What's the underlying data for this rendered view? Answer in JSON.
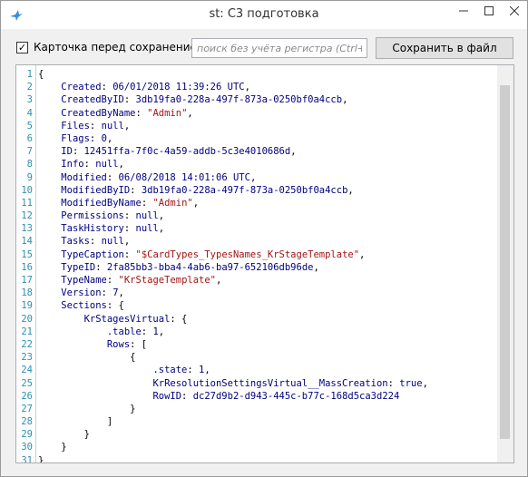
{
  "window": {
    "title": "st: C3 подготовка"
  },
  "toolbar": {
    "checkbox_label": "Карточка перед сохранением",
    "checkbox_checked": true,
    "search_placeholder": "поиск без учёта регистра (Ctrl+F",
    "save_label": "Сохранить в файл"
  },
  "editor": {
    "lines": [
      {
        "n": "1",
        "segments": [
          [
            "{",
            "p"
          ]
        ]
      },
      {
        "n": "2",
        "segments": [
          [
            "    ",
            "p"
          ],
          [
            "Created",
            "k"
          ],
          [
            ": ",
            "p"
          ],
          [
            "06/01/2018 11:39:26 UTC",
            "v"
          ],
          [
            ",",
            "p"
          ]
        ]
      },
      {
        "n": "3",
        "segments": [
          [
            "    ",
            "p"
          ],
          [
            "CreatedByID",
            "k"
          ],
          [
            ": ",
            "p"
          ],
          [
            "3db19fa0-228a-497f-873a-0250bf0a4ccb",
            "v"
          ],
          [
            ",",
            "p"
          ]
        ]
      },
      {
        "n": "4",
        "segments": [
          [
            "    ",
            "p"
          ],
          [
            "CreatedByName",
            "k"
          ],
          [
            ": ",
            "p"
          ],
          [
            "\"Admin\"",
            "s"
          ],
          [
            ",",
            "p"
          ]
        ]
      },
      {
        "n": "5",
        "segments": [
          [
            "    ",
            "p"
          ],
          [
            "Files",
            "k"
          ],
          [
            ": ",
            "p"
          ],
          [
            "null",
            "n"
          ],
          [
            ",",
            "p"
          ]
        ]
      },
      {
        "n": "6",
        "segments": [
          [
            "    ",
            "p"
          ],
          [
            "Flags",
            "k"
          ],
          [
            ": ",
            "p"
          ],
          [
            "0",
            "v"
          ],
          [
            ",",
            "p"
          ]
        ]
      },
      {
        "n": "7",
        "segments": [
          [
            "    ",
            "p"
          ],
          [
            "ID",
            "k"
          ],
          [
            ": ",
            "p"
          ],
          [
            "12451ffa-7f0c-4a59-addb-5c3e4010686d",
            "v"
          ],
          [
            ",",
            "p"
          ]
        ]
      },
      {
        "n": "8",
        "segments": [
          [
            "    ",
            "p"
          ],
          [
            "Info",
            "k"
          ],
          [
            ": ",
            "p"
          ],
          [
            "null",
            "n"
          ],
          [
            ",",
            "p"
          ]
        ]
      },
      {
        "n": "9",
        "segments": [
          [
            "    ",
            "p"
          ],
          [
            "Modified",
            "k"
          ],
          [
            ": ",
            "p"
          ],
          [
            "06/08/2018 14:01:06 UTC",
            "v"
          ],
          [
            ",",
            "p"
          ]
        ]
      },
      {
        "n": "10",
        "segments": [
          [
            "    ",
            "p"
          ],
          [
            "ModifiedByID",
            "k"
          ],
          [
            ": ",
            "p"
          ],
          [
            "3db19fa0-228a-497f-873a-0250bf0a4ccb",
            "v"
          ],
          [
            ",",
            "p"
          ]
        ]
      },
      {
        "n": "11",
        "segments": [
          [
            "    ",
            "p"
          ],
          [
            "ModifiedByName",
            "k"
          ],
          [
            ": ",
            "p"
          ],
          [
            "\"Admin\"",
            "s"
          ],
          [
            ",",
            "p"
          ]
        ]
      },
      {
        "n": "12",
        "segments": [
          [
            "    ",
            "p"
          ],
          [
            "Permissions",
            "k"
          ],
          [
            ": ",
            "p"
          ],
          [
            "null",
            "n"
          ],
          [
            ",",
            "p"
          ]
        ]
      },
      {
        "n": "13",
        "segments": [
          [
            "    ",
            "p"
          ],
          [
            "TaskHistory",
            "k"
          ],
          [
            ": ",
            "p"
          ],
          [
            "null",
            "n"
          ],
          [
            ",",
            "p"
          ]
        ]
      },
      {
        "n": "14",
        "segments": [
          [
            "    ",
            "p"
          ],
          [
            "Tasks",
            "k"
          ],
          [
            ": ",
            "p"
          ],
          [
            "null",
            "n"
          ],
          [
            ",",
            "p"
          ]
        ]
      },
      {
        "n": "15",
        "segments": [
          [
            "    ",
            "p"
          ],
          [
            "TypeCaption",
            "k"
          ],
          [
            ": ",
            "p"
          ],
          [
            "\"$CardTypes_TypesNames_KrStageTemplate\"",
            "s"
          ],
          [
            ",",
            "p"
          ]
        ]
      },
      {
        "n": "16",
        "segments": [
          [
            "    ",
            "p"
          ],
          [
            "TypeID",
            "k"
          ],
          [
            ": ",
            "p"
          ],
          [
            "2fa85bb3-bba4-4ab6-ba97-652106db96de",
            "v"
          ],
          [
            ",",
            "p"
          ]
        ]
      },
      {
        "n": "17",
        "segments": [
          [
            "    ",
            "p"
          ],
          [
            "TypeName",
            "k"
          ],
          [
            ": ",
            "p"
          ],
          [
            "\"KrStageTemplate\"",
            "s"
          ],
          [
            ",",
            "p"
          ]
        ]
      },
      {
        "n": "18",
        "segments": [
          [
            "    ",
            "p"
          ],
          [
            "Version",
            "k"
          ],
          [
            ": ",
            "p"
          ],
          [
            "7",
            "v"
          ],
          [
            ",",
            "p"
          ]
        ]
      },
      {
        "n": "19",
        "segments": [
          [
            "    ",
            "p"
          ],
          [
            "Sections",
            "k"
          ],
          [
            ": {",
            "p"
          ]
        ]
      },
      {
        "n": "20",
        "segments": [
          [
            "        ",
            "p"
          ],
          [
            "KrStagesVirtual",
            "k"
          ],
          [
            ": {",
            "p"
          ]
        ]
      },
      {
        "n": "21",
        "segments": [
          [
            "            ",
            "p"
          ],
          [
            ".table",
            "k"
          ],
          [
            ": ",
            "p"
          ],
          [
            "1",
            "v"
          ],
          [
            ",",
            "p"
          ]
        ]
      },
      {
        "n": "22",
        "segments": [
          [
            "            ",
            "p"
          ],
          [
            "Rows",
            "k"
          ],
          [
            ": [",
            "p"
          ]
        ]
      },
      {
        "n": "23",
        "segments": [
          [
            "                {",
            "p"
          ]
        ]
      },
      {
        "n": "24",
        "segments": [
          [
            "                    ",
            "p"
          ],
          [
            ".state",
            "k"
          ],
          [
            ": ",
            "p"
          ],
          [
            "1",
            "v"
          ],
          [
            ",",
            "p"
          ]
        ]
      },
      {
        "n": "25",
        "segments": [
          [
            "                    ",
            "p"
          ],
          [
            "KrResolutionSettingsVirtual__MassCreation",
            "k"
          ],
          [
            ": ",
            "p"
          ],
          [
            "true",
            "n"
          ],
          [
            ",",
            "p"
          ]
        ]
      },
      {
        "n": "26",
        "segments": [
          [
            "                    ",
            "p"
          ],
          [
            "RowID",
            "k"
          ],
          [
            ": ",
            "p"
          ],
          [
            "dc27d9b2-d943-445c-b77c-168d5ca3d224",
            "v"
          ]
        ]
      },
      {
        "n": "27",
        "segments": [
          [
            "                }",
            "p"
          ]
        ]
      },
      {
        "n": "28",
        "segments": [
          [
            "            ]",
            "p"
          ]
        ]
      },
      {
        "n": "29",
        "segments": [
          [
            "        }",
            "p"
          ]
        ]
      },
      {
        "n": "30",
        "segments": [
          [
            "    }",
            "p"
          ]
        ]
      },
      {
        "n": "31",
        "segments": [
          [
            "}",
            "p"
          ]
        ]
      }
    ]
  }
}
